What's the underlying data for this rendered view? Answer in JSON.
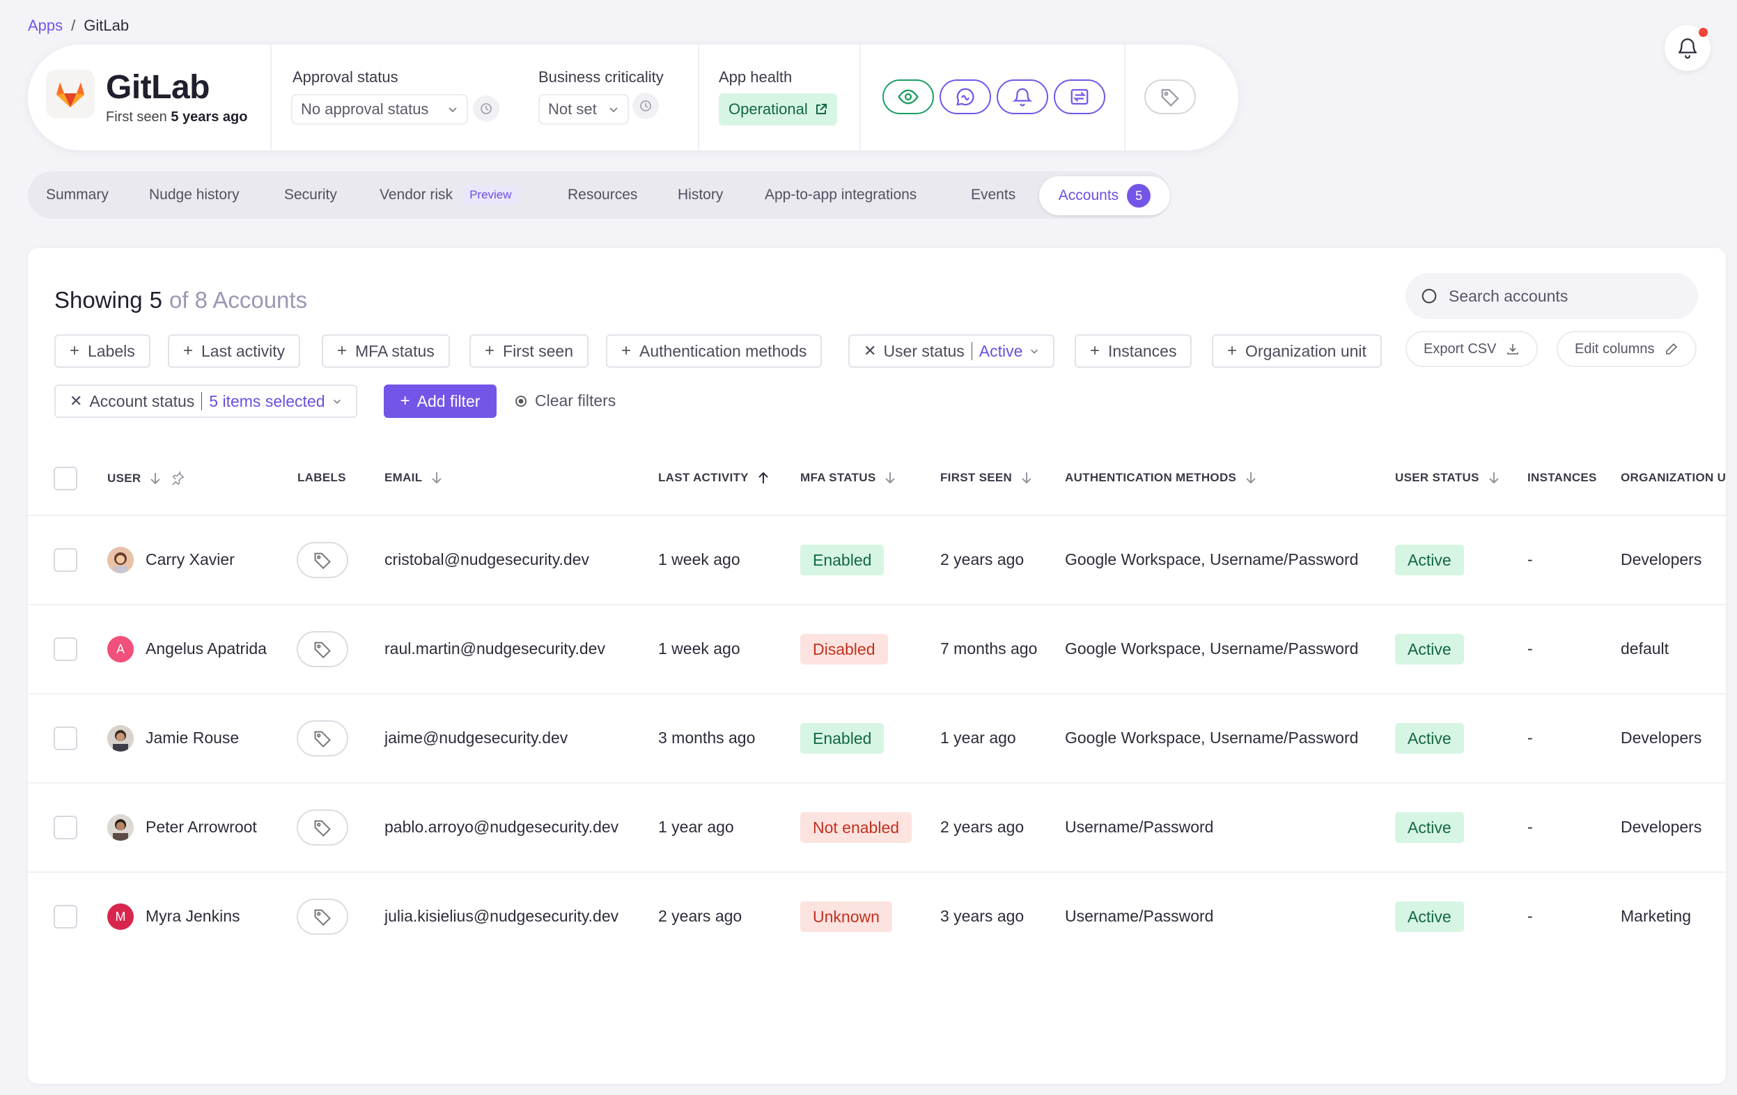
{
  "breadcrumb": {
    "root": "Apps",
    "separator": "/",
    "current": "GitLab"
  },
  "app": {
    "name": "GitLab",
    "first_seen_prefix": "First seen",
    "first_seen_value": "5 years ago"
  },
  "approval": {
    "label": "Approval status",
    "value": "No approval status"
  },
  "criticality": {
    "label": "Business criticality",
    "value": "Not set"
  },
  "health": {
    "label": "App health",
    "value": "Operational"
  },
  "header_actions": [
    "eye-icon",
    "chat-icon",
    "bell-icon",
    "swap-icon",
    "tag-icon"
  ],
  "tabs": [
    {
      "label": "Summary"
    },
    {
      "label": "Nudge history"
    },
    {
      "label": "Security"
    },
    {
      "label": "Vendor risk",
      "badge": "Preview"
    },
    {
      "label": "Resources"
    },
    {
      "label": "History"
    },
    {
      "label": "App-to-app integrations"
    },
    {
      "label": "Events"
    },
    {
      "label": "Accounts",
      "count": "5",
      "active": true
    }
  ],
  "showing": {
    "prefix": "Showing",
    "count": "5",
    "suffix": "of 8 Accounts"
  },
  "search": {
    "placeholder": "Search accounts"
  },
  "actions": {
    "export": "Export CSV",
    "edit_columns": "Edit columns"
  },
  "filters": {
    "labels": "Labels",
    "last_activity": "Last activity",
    "mfa_status": "MFA status",
    "first_seen": "First seen",
    "auth_methods": "Authentication methods",
    "user_status_label": "User status",
    "user_status_value": "Active",
    "instances": "Instances",
    "org_unit": "Organization unit",
    "account_status_label": "Account status",
    "account_status_value": "5 items selected",
    "add_filter": "Add filter",
    "clear_filters": "Clear filters"
  },
  "columns": {
    "user": "USER",
    "labels": "LABELS",
    "email": "EMAIL",
    "last_activity": "LAST ACTIVITY",
    "mfa_status": "MFA STATUS",
    "first_seen": "FIRST SEEN",
    "auth_methods": "AUTHENTICATION METHODS",
    "user_status": "USER STATUS",
    "instances": "INSTANCES",
    "org_unit": "ORGANIZATION U"
  },
  "rows": [
    {
      "name": "Carry Xavier",
      "email": "cristobal@nudgesecurity.dev",
      "last_activity": "1 week ago",
      "mfa": "Enabled",
      "first_seen": "2 years ago",
      "auth": "Google Workspace, Username/Password",
      "status": "Active",
      "instances": "-",
      "org": "Developers"
    },
    {
      "name": "Angelus Apatrida",
      "initial": "A",
      "email": "raul.martin@nudgesecurity.dev",
      "last_activity": "1 week ago",
      "mfa": "Disabled",
      "first_seen": "7 months ago",
      "auth": "Google Workspace, Username/Password",
      "status": "Active",
      "instances": "-",
      "org": "default"
    },
    {
      "name": "Jamie Rouse",
      "email": "jaime@nudgesecurity.dev",
      "last_activity": "3 months ago",
      "mfa": "Enabled",
      "first_seen": "1 year ago",
      "auth": "Google Workspace, Username/Password",
      "status": "Active",
      "instances": "-",
      "org": "Developers"
    },
    {
      "name": "Peter Arrowroot",
      "email": "pablo.arroyo@nudgesecurity.dev",
      "last_activity": "1 year ago",
      "mfa": "Not enabled",
      "first_seen": "2 years ago",
      "auth": "Username/Password",
      "status": "Active",
      "instances": "-",
      "org": "Developers"
    },
    {
      "name": "Myra Jenkins",
      "initial": "M",
      "email": "julia.kisielius@nudgesecurity.dev",
      "last_activity": "2 years ago",
      "mfa": "Unknown",
      "first_seen": "3 years ago",
      "auth": "Username/Password",
      "status": "Active",
      "instances": "-",
      "org": "Marketing"
    }
  ],
  "colors": {
    "accent": "#7356e8",
    "success_bg": "#d7f5e3",
    "success_fg": "#12683f",
    "danger_bg": "#fde3df",
    "danger_fg": "#c2301f"
  }
}
